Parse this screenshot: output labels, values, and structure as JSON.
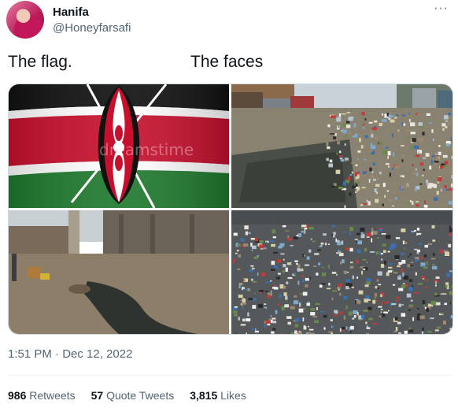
{
  "author": {
    "display_name": "Hanifa",
    "handle": "@Honeyfarsafi"
  },
  "more_icon": "more-horizontal-icon",
  "captions": {
    "left": "The flag.",
    "right": "The faces"
  },
  "media": [
    {
      "name": "kenya-flag-image",
      "watermark": "dreamstime"
    },
    {
      "name": "flooded-garbage-street-image"
    },
    {
      "name": "sewage-channel-image"
    },
    {
      "name": "garbage-heap-image"
    }
  ],
  "timestamp": "1:51 PM · Dec 12, 2022",
  "stats": {
    "retweets": {
      "count": "986",
      "label": "Retweets"
    },
    "quote_tweets": {
      "count": "57",
      "label": "Quote Tweets"
    },
    "likes": {
      "count": "3,815",
      "label": "Likes"
    }
  },
  "colors": {
    "flag_black": "#111111",
    "flag_red": "#c8102e",
    "flag_green": "#1f7a2e",
    "text_secondary": "#536471"
  }
}
